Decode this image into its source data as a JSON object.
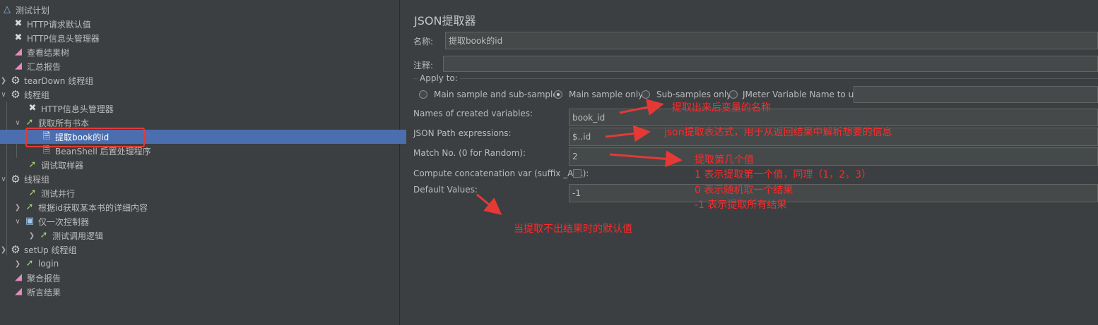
{
  "tree": {
    "items": [
      {
        "label": "测试计划",
        "icon": "test-plan-icon",
        "arrow": "none"
      },
      {
        "label": "HTTP请求默认值",
        "icon": "wrench-icon",
        "arrow": "none"
      },
      {
        "label": "HTTP信息头管理器",
        "icon": "wrench-icon",
        "arrow": "none"
      },
      {
        "label": "查看结果树",
        "icon": "chart-icon",
        "arrow": "none"
      },
      {
        "label": "汇总报告",
        "icon": "chart-icon",
        "arrow": "none"
      },
      {
        "label": "tearDown 线程组",
        "icon": "gear-icon",
        "arrow": "collapsed"
      },
      {
        "label": "线程组",
        "icon": "gear-icon",
        "arrow": "expanded"
      },
      {
        "label": "HTTP信息头管理器",
        "icon": "wrench-icon",
        "arrow": "none"
      },
      {
        "label": "获取所有书本",
        "icon": "sampler-icon",
        "arrow": "expanded"
      },
      {
        "label": "提取book的id",
        "icon": "extractor-icon",
        "arrow": "none"
      },
      {
        "label": "BeanShell 后置处理程序",
        "icon": "postprocessor-icon",
        "arrow": "none"
      },
      {
        "label": "调试取样器",
        "icon": "sampler-icon",
        "arrow": "none"
      },
      {
        "label": "线程组",
        "icon": "gear-icon",
        "arrow": "expanded"
      },
      {
        "label": "测试并行",
        "icon": "sampler-icon",
        "arrow": "none"
      },
      {
        "label": "根据id获取某本书的详细内容",
        "icon": "sampler-icon",
        "arrow": "collapsed"
      },
      {
        "label": "仅一次控制器",
        "icon": "controller-icon",
        "arrow": "expanded"
      },
      {
        "label": "测试调用逻辑",
        "icon": "sampler-icon",
        "arrow": "collapsed"
      },
      {
        "label": "setUp 线程组",
        "icon": "gear-icon",
        "arrow": "collapsed"
      },
      {
        "label": "login",
        "icon": "sampler-icon",
        "arrow": "collapsed"
      },
      {
        "label": "聚合报告",
        "icon": "chart-icon",
        "arrow": "none"
      },
      {
        "label": "断言结果",
        "icon": "chart-icon",
        "arrow": "none"
      }
    ]
  },
  "panel": {
    "title": "JSON提取器",
    "name_label": "名称:",
    "name_value": "提取book的id",
    "comment_label": "注释:",
    "comment_value": "",
    "apply_to": {
      "label": "Apply to:",
      "options": [
        "Main sample and sub-samples",
        "Main sample only",
        "Sub-samples only",
        "JMeter Variable Name to use"
      ],
      "selected": "Main sample only",
      "variable_value": ""
    },
    "variables_label": "Names of created variables:",
    "variables_value": "book_id",
    "json_path_label": "JSON Path expressions:",
    "json_path_value": "$..id",
    "match_no_label": "Match No. (0 for Random):",
    "match_no_value": "2",
    "concat_label": "Compute concatenation var (suffix _ALL):",
    "concat_checked": false,
    "default_label": "Default Values:",
    "default_value": "-1"
  },
  "annotations": {
    "variable_name": "提取出来后变量的名称",
    "json_path": "json提取表达式，用于从返回结果中解析想要的信息",
    "match_no_title": "提取第几个值",
    "match_no_line1": "1  表示提取第一个值，同理（1，2，3）",
    "match_no_line2": "0  表示随机取一个结果",
    "match_no_line3": "-1 表示提取所有结果",
    "default_value": "当提取不出结果时的默认值",
    "color": "#ff2a2a"
  }
}
